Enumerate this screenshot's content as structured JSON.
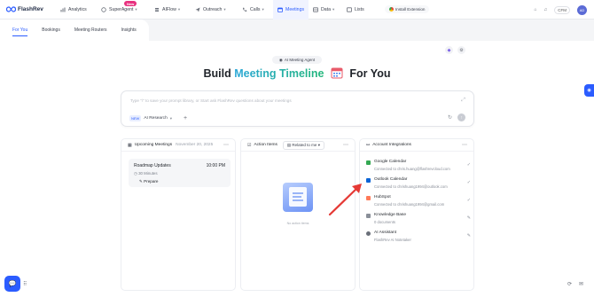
{
  "app": {
    "name": "FlashRev"
  },
  "nav": {
    "items": [
      {
        "label": "Analytics",
        "icon": "chart-icon"
      },
      {
        "label": "SuperAgent",
        "icon": "agent-icon",
        "badge": "New"
      },
      {
        "label": "AIFlow",
        "icon": "flow-icon"
      },
      {
        "label": "Outreach",
        "icon": "send-icon"
      },
      {
        "label": "Calls",
        "icon": "phone-icon"
      },
      {
        "label": "Meetings",
        "icon": "calendar-icon"
      },
      {
        "label": "Data",
        "icon": "database-icon"
      },
      {
        "label": "Lists",
        "icon": "list-icon"
      }
    ],
    "install": "Install Extension",
    "cfm": "CFM",
    "avatar": "AD"
  },
  "subtabs": [
    {
      "label": "For You"
    },
    {
      "label": "Bookings"
    },
    {
      "label": "Meeting Routers"
    },
    {
      "label": "Insights"
    }
  ],
  "hero": {
    "pill": "AI Meeting Agent",
    "headline_pre": "Build",
    "headline_highlight": "Meeting Timeline",
    "headline_post": "For You"
  },
  "prompt": {
    "placeholder": "Type \"/\" to save your prompt library, or Start ask FlashRev questions about your meetings",
    "new_tag": "NEW",
    "research": "AI Research"
  },
  "upcoming": {
    "title": "Upcoming Meetings",
    "date": "November 20, 2025",
    "meeting": {
      "title": "Roadmap Updates",
      "time": "10:00 PM",
      "duration": "30 Minutes",
      "prepare": "Prepare"
    }
  },
  "actions": {
    "title": "Action Items",
    "filter": "Related to me",
    "empty": "No action items"
  },
  "integrations": {
    "title": "Account Integrations",
    "items": [
      {
        "name": "Google Calendar",
        "sub": "Connected to chris.huang@flashrevcloud.com",
        "color": "#34a853"
      },
      {
        "name": "Outlook Calendar",
        "sub": "Connected to chrishuang1994@outlook.com",
        "color": "#0a64d6"
      },
      {
        "name": "HubSpot",
        "sub": "Connected to chrishuang1994@gmail.com",
        "color": "#ff7a59"
      },
      {
        "name": "Knowledge Base",
        "sub": "0 documents",
        "color": "#8a8f99"
      },
      {
        "name": "AI Assistant",
        "sub": "FlashRev AI Notetaker",
        "color": "#6a6f79"
      }
    ]
  },
  "colors": {
    "accent": "#2b5cff",
    "badge": "#e8317f",
    "arrow": "#e53935"
  }
}
